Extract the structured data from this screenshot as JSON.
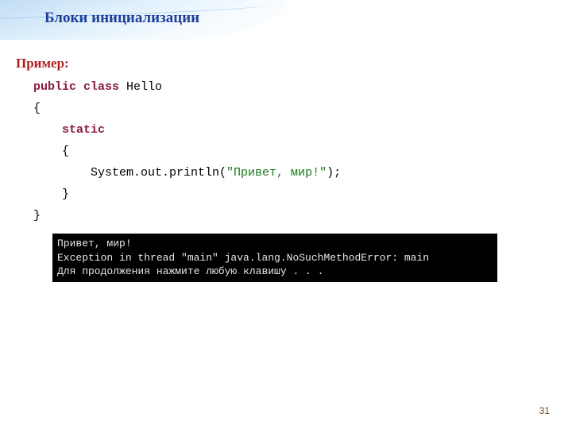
{
  "slide": {
    "title": "Блоки инициализации",
    "page_number": "31"
  },
  "example": {
    "label": "Пример:",
    "code_tokens": {
      "kw_public": "public",
      "kw_class": "class",
      "class_name": " Hello",
      "open_brace": "{",
      "kw_static": "static",
      "open_brace2": "{",
      "stmt_prefix": "System.out.println(",
      "string_literal": "\"Привет, мир!\"",
      "stmt_suffix": ");",
      "close_brace2": "}",
      "close_brace": "}"
    }
  },
  "console": {
    "line1": "Привет, мир!",
    "line2": "Exception in thread \"main\" java.lang.NoSuchMethodError: main",
    "line3": "Для продолжения нажмите любую клавишу . . ."
  }
}
